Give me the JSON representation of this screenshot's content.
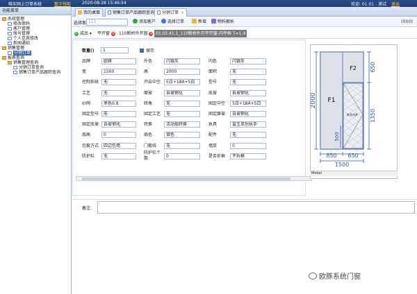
{
  "app": {
    "title": "唯实网上订单系统",
    "help_link": "数字钱柜",
    "datetime": "2020-08-28 15:46:54",
    "welcome": "欢迎: 01.01 - 测试",
    "logout": "退出"
  },
  "sidebar": {
    "header": "功能菜单",
    "items": [
      {
        "label": "系统管理",
        "type": "folder",
        "level": 0
      },
      {
        "label": "修改密码",
        "type": "page",
        "level": 1
      },
      {
        "label": "客户管理",
        "type": "page",
        "level": 1
      },
      {
        "label": "账号管理",
        "type": "page",
        "level": 1
      },
      {
        "label": "个人信息修改",
        "type": "page",
        "level": 1
      },
      {
        "label": "新闻通知",
        "type": "page",
        "level": 1
      },
      {
        "label": "销售管理",
        "type": "folder",
        "level": 0
      },
      {
        "label": "分销订单",
        "type": "page",
        "level": 1,
        "selected": true
      },
      {
        "label": "报表查询",
        "type": "folder",
        "level": 0
      },
      {
        "label": "销售管理查询",
        "type": "folder",
        "level": 1
      },
      {
        "label": "分销订单查询",
        "type": "page",
        "level": 2
      },
      {
        "label": "销售订单产品跟踪查询",
        "type": "page",
        "level": 2
      }
    ]
  },
  "tabs": [
    {
      "label": "我的桌面"
    },
    {
      "label": "销售订单产品跟踪查询"
    },
    {
      "label": "分销订单",
      "active": true
    }
  ],
  "toolbar": {
    "customer_label": "选择客户:",
    "customer_value": "111",
    "customer_code": "(0)(0)",
    "buttons": [
      "添加客户",
      "选择订单",
      "新增",
      "物料解析"
    ]
  },
  "subtabs": {
    "product_btn": "成品",
    "items": [
      "平开窗",
      "110断桥外开窗",
      "01.02.41.1_110断桥外开平开窗-内平框 T=1.4"
    ]
  },
  "form": {
    "qty_label": "数量()",
    "qty_value": "1",
    "save_label": "保存",
    "rows": [
      [
        [
          "品牌",
          "欧豚"
        ],
        [
          "外色",
          "闪银灰"
        ],
        [
          "内色",
          "闪银灰"
        ]
      ],
      [
        [
          "宽",
          "1500"
        ],
        [
          "高",
          "2000"
        ],
        [
          "面积",
          "无"
        ]
      ],
      [
        [
          "控制系统",
          "无"
        ],
        [
          "开启中空",
          "5白+18A+5白"
        ],
        [
          "型号",
          "无"
        ]
      ],
      [
        [
          "工艺",
          "无"
        ],
        [
          "面玻",
          "自玻钢化"
        ],
        [
          "底玻",
          "自玻钢化"
        ]
      ],
      [
        [
          "纱网",
          "黑色0.8"
        ],
        [
          "转角",
          "无"
        ],
        [
          "固定中空",
          "5白+18A+5白"
        ]
      ],
      [
        [
          "固定型号",
          "无"
        ],
        [
          "固定工艺",
          "无"
        ],
        [
          "固定面玻",
          "自玻钢化"
        ]
      ],
      [
        [
          "固定底玻",
          "自玻钢化"
        ],
        [
          "转换",
          "活动扇转换"
        ],
        [
          "执具",
          "雷圭单拐执手"
        ]
      ],
      [
        [
          "扇高",
          "0"
        ],
        [
          "扇色",
          "银色"
        ],
        [
          "配件",
          "无"
        ]
      ],
      [
        [
          "包套方式",
          "四边包墙"
        ],
        [
          "门套线",
          "无"
        ],
        [
          "墙厚",
          "0"
        ]
      ],
      [
        [
          "防护栏",
          "无"
        ],
        [
          "防护栏个数",
          "0"
        ],
        [
          "是否折框",
          "不拆框"
        ]
      ]
    ]
  },
  "drawing": {
    "pane_left": "F1",
    "pane_right_top": "F2",
    "sash_label": "外开内开",
    "dim_total_height": "2000",
    "dim_top_right": "650",
    "dim_bottom_right": "1350",
    "dim_width_left": "850",
    "dim_width_right": "650",
    "dim_total_width": "1500",
    "dim_handle": "500",
    "modal_label": "Modal"
  },
  "remark": {
    "label": "备注:",
    "value": ""
  },
  "watermark": "欧豚系统门窗",
  "colors": {
    "header": "#2a4f8a",
    "accent": "#3063b5",
    "frame": "#6a7fae",
    "dim": "#2a5aa8"
  }
}
